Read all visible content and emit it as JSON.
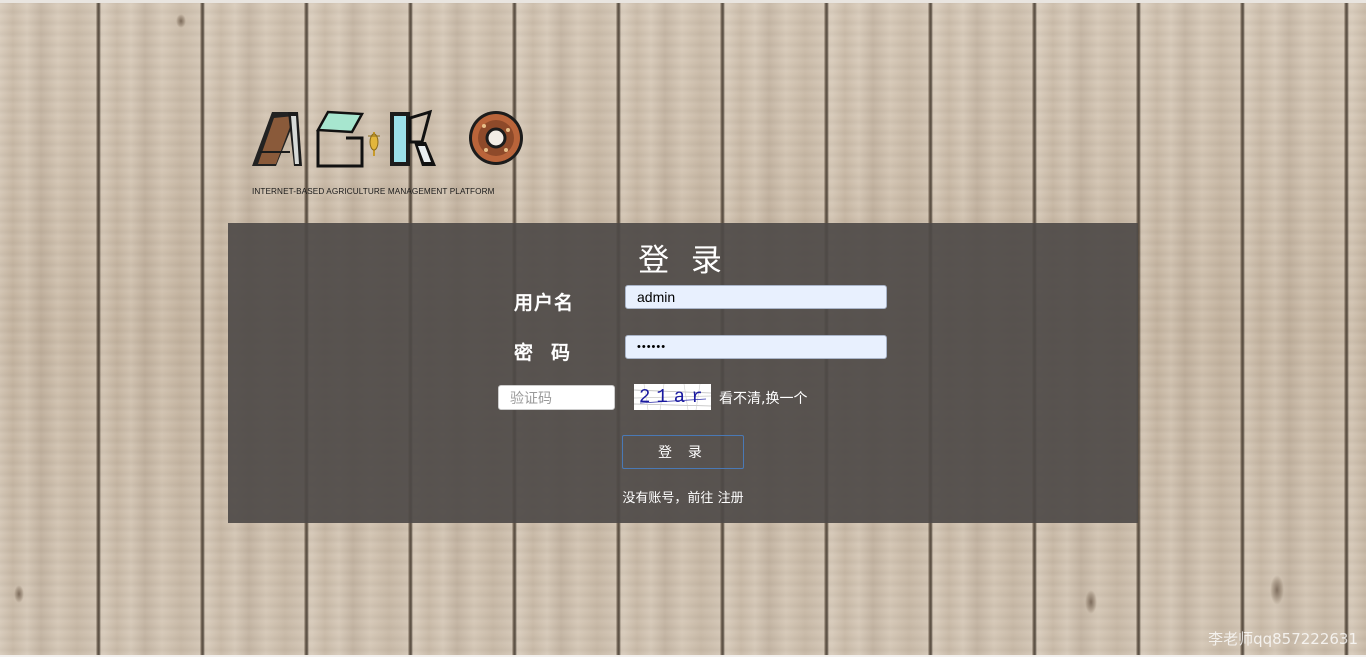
{
  "logo": {
    "letters": [
      "A",
      "G",
      "R",
      "O"
    ],
    "tagline": "INTERNET-BASED AGRICULTURE MANAGEMENT PLATFORM"
  },
  "login": {
    "title": "登 录",
    "username_label": "用户名",
    "username_value": "admin",
    "password_label": "密码",
    "password_value": "••••••",
    "captcha_placeholder": "验证码",
    "captcha_image_text": "21ar",
    "refresh_label": "看不清,换一个",
    "submit_label": "登 录",
    "register_prompt": "没有账号，前往",
    "register_link": "注册"
  },
  "watermark": "李老师qq857222631",
  "colors": {
    "panel_bg": "#4e4a48",
    "input_bg": "#e8f0fe",
    "button_border": "#4a79b5",
    "captcha_text": "#1a1aa0"
  }
}
